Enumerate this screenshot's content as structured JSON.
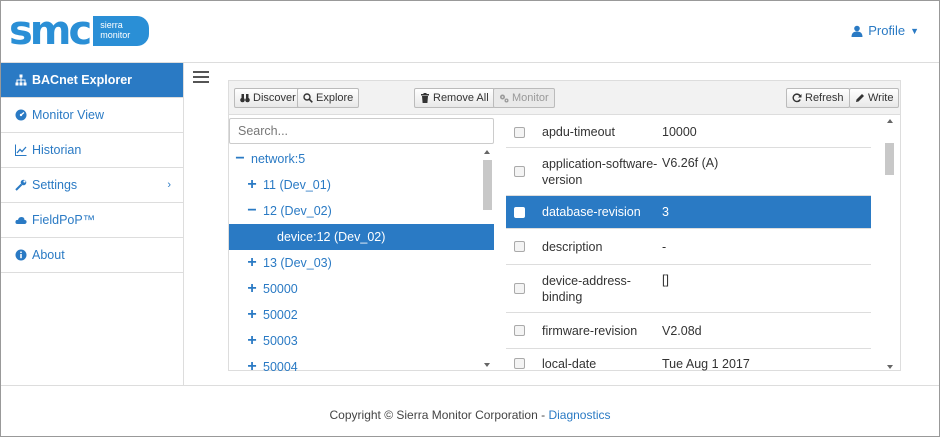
{
  "brand": {
    "logo_text": "smc",
    "logo_sub_line1": "sierra",
    "logo_sub_line2": "monitor"
  },
  "header": {
    "profile_label": "Profile"
  },
  "sidebar": {
    "items": [
      {
        "label": "BACnet Explorer",
        "icon": "sitemap-icon"
      },
      {
        "label": "Monitor View",
        "icon": "dashboard-icon"
      },
      {
        "label": "Historian",
        "icon": "line-chart-icon"
      },
      {
        "label": "Settings",
        "icon": "wrench-icon",
        "chevron": "›"
      },
      {
        "label": "FieldPoP™",
        "icon": "cloud-icon"
      },
      {
        "label": "About",
        "icon": "info-icon"
      }
    ]
  },
  "toolbar": {
    "discover": "Discover",
    "explore": "Explore",
    "remove_all": "Remove All",
    "monitor": "Monitor",
    "refresh": "Refresh",
    "write": "Write"
  },
  "search": {
    "placeholder": "Search..."
  },
  "tree": [
    {
      "sign": "−",
      "label": "network:5"
    },
    {
      "sign": "+",
      "label": "11 (Dev_01)"
    },
    {
      "sign": "−",
      "label": "12 (Dev_02)"
    },
    {
      "sign": "",
      "label": "device:12 (Dev_02)"
    },
    {
      "sign": "+",
      "label": "13 (Dev_03)"
    },
    {
      "sign": "+",
      "label": "50000"
    },
    {
      "sign": "+",
      "label": "50002"
    },
    {
      "sign": "+",
      "label": "50003"
    },
    {
      "sign": "+",
      "label": "50004"
    }
  ],
  "properties": [
    {
      "name": "apdu-timeout",
      "value": "10000"
    },
    {
      "name": "application-software-version",
      "value": "V6.26f (A)"
    },
    {
      "name": "database-revision",
      "value": "3"
    },
    {
      "name": "description",
      "value": "-"
    },
    {
      "name": "device-address-binding",
      "value": "[]"
    },
    {
      "name": "firmware-revision",
      "value": "V2.08d"
    },
    {
      "name": "local-date",
      "value": "Tue Aug 1 2017"
    }
  ],
  "footer": {
    "copyright": "Copyright © Sierra Monitor Corporation - ",
    "link": "Diagnostics"
  },
  "colors": {
    "accent": "#2a7ac4"
  }
}
